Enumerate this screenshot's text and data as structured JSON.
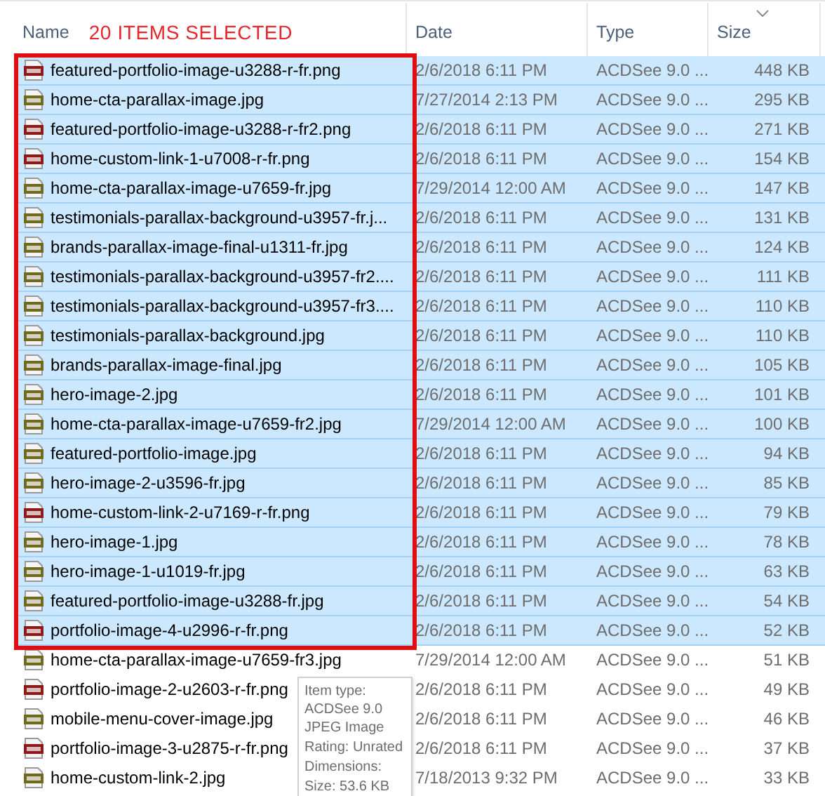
{
  "columns": [
    {
      "label": "Name",
      "sorted": false
    },
    {
      "label": "Date",
      "sorted": false
    },
    {
      "label": "Type",
      "sorted": false
    },
    {
      "label": "Size",
      "sorted": true
    }
  ],
  "annotation": "20 ITEMS SELECTED",
  "rows": [
    {
      "kind": "png",
      "name": "featured-portfolio-image-u3288-r-fr.png",
      "date": "2/6/2018 6:11 PM",
      "type": "ACDSee 9.0 ...",
      "size": "448 KB",
      "selected": true
    },
    {
      "kind": "jpg",
      "name": "home-cta-parallax-image.jpg",
      "date": "7/27/2014 2:13 PM",
      "type": "ACDSee 9.0 ...",
      "size": "295 KB",
      "selected": true
    },
    {
      "kind": "png",
      "name": "featured-portfolio-image-u3288-r-fr2.png",
      "date": "2/6/2018 6:11 PM",
      "type": "ACDSee 9.0 ...",
      "size": "271 KB",
      "selected": true
    },
    {
      "kind": "png",
      "name": "home-custom-link-1-u7008-r-fr.png",
      "date": "2/6/2018 6:11 PM",
      "type": "ACDSee 9.0 ...",
      "size": "154 KB",
      "selected": true
    },
    {
      "kind": "jpg",
      "name": "home-cta-parallax-image-u7659-fr.jpg",
      "date": "7/29/2014 12:00 AM",
      "type": "ACDSee 9.0 ...",
      "size": "147 KB",
      "selected": true
    },
    {
      "kind": "jpg",
      "name": "testimonials-parallax-background-u3957-fr.j...",
      "date": "2/6/2018 6:11 PM",
      "type": "ACDSee 9.0 ...",
      "size": "131 KB",
      "selected": true
    },
    {
      "kind": "jpg",
      "name": "brands-parallax-image-final-u1311-fr.jpg",
      "date": "2/6/2018 6:11 PM",
      "type": "ACDSee 9.0 ...",
      "size": "124 KB",
      "selected": true
    },
    {
      "kind": "jpg",
      "name": "testimonials-parallax-background-u3957-fr2....",
      "date": "2/6/2018 6:11 PM",
      "type": "ACDSee 9.0 ...",
      "size": "111 KB",
      "selected": true
    },
    {
      "kind": "jpg",
      "name": "testimonials-parallax-background-u3957-fr3....",
      "date": "2/6/2018 6:11 PM",
      "type": "ACDSee 9.0 ...",
      "size": "110 KB",
      "selected": true
    },
    {
      "kind": "jpg",
      "name": "testimonials-parallax-background.jpg",
      "date": "2/6/2018 6:11 PM",
      "type": "ACDSee 9.0 ...",
      "size": "110 KB",
      "selected": true
    },
    {
      "kind": "jpg",
      "name": "brands-parallax-image-final.jpg",
      "date": "2/6/2018 6:11 PM",
      "type": "ACDSee 9.0 ...",
      "size": "105 KB",
      "selected": true
    },
    {
      "kind": "jpg",
      "name": "hero-image-2.jpg",
      "date": "2/6/2018 6:11 PM",
      "type": "ACDSee 9.0 ...",
      "size": "101 KB",
      "selected": true
    },
    {
      "kind": "jpg",
      "name": "home-cta-parallax-image-u7659-fr2.jpg",
      "date": "7/29/2014 12:00 AM",
      "type": "ACDSee 9.0 ...",
      "size": "100 KB",
      "selected": true
    },
    {
      "kind": "jpg",
      "name": "featured-portfolio-image.jpg",
      "date": "2/6/2018 6:11 PM",
      "type": "ACDSee 9.0 ...",
      "size": "94 KB",
      "selected": true
    },
    {
      "kind": "jpg",
      "name": "hero-image-2-u3596-fr.jpg",
      "date": "2/6/2018 6:11 PM",
      "type": "ACDSee 9.0 ...",
      "size": "85 KB",
      "selected": true
    },
    {
      "kind": "png",
      "name": "home-custom-link-2-u7169-r-fr.png",
      "date": "2/6/2018 6:11 PM",
      "type": "ACDSee 9.0 ...",
      "size": "79 KB",
      "selected": true
    },
    {
      "kind": "jpg",
      "name": "hero-image-1.jpg",
      "date": "2/6/2018 6:11 PM",
      "type": "ACDSee 9.0 ...",
      "size": "78 KB",
      "selected": true
    },
    {
      "kind": "jpg",
      "name": "hero-image-1-u1019-fr.jpg",
      "date": "2/6/2018 6:11 PM",
      "type": "ACDSee 9.0 ...",
      "size": "63 KB",
      "selected": true
    },
    {
      "kind": "jpg",
      "name": "featured-portfolio-image-u3288-fr.jpg",
      "date": "2/6/2018 6:11 PM",
      "type": "ACDSee 9.0 ...",
      "size": "54 KB",
      "selected": true
    },
    {
      "kind": "png",
      "name": "portfolio-image-4-u2996-r-fr.png",
      "date": "2/6/2018 6:11 PM",
      "type": "ACDSee 9.0 ...",
      "size": "52 KB",
      "selected": true
    },
    {
      "kind": "jpg",
      "name": "home-cta-parallax-image-u7659-fr3.jpg",
      "date": "7/29/2014 12:00 AM",
      "type": "ACDSee 9.0 ...",
      "size": "51 KB",
      "selected": false
    },
    {
      "kind": "png",
      "name": "portfolio-image-2-u2603-r-fr.png",
      "date": "2/6/2018 6:11 PM",
      "type": "ACDSee 9.0 ...",
      "size": "49 KB",
      "selected": false
    },
    {
      "kind": "jpg",
      "name": "mobile-menu-cover-image.jpg",
      "date": "2/6/2018 6:11 PM",
      "type": "ACDSee 9.0 ...",
      "size": "46 KB",
      "selected": false
    },
    {
      "kind": "png",
      "name": "portfolio-image-3-u2875-r-fr.png",
      "date": "2/6/2018 6:11 PM",
      "type": "ACDSee 9.0 ...",
      "size": "37 KB",
      "selected": false
    },
    {
      "kind": "jpg",
      "name": "home-custom-link-2.jpg",
      "date": "7/18/2013 9:32 PM",
      "type": "ACDSee 9.0 ...",
      "size": "33 KB",
      "selected": false
    }
  ],
  "tooltip": {
    "lines": [
      "Item type: ACDSee 9.0 JPEG Image",
      "Rating: Unrated",
      "Dimensions:",
      "Size: 53.6 KB"
    ]
  }
}
